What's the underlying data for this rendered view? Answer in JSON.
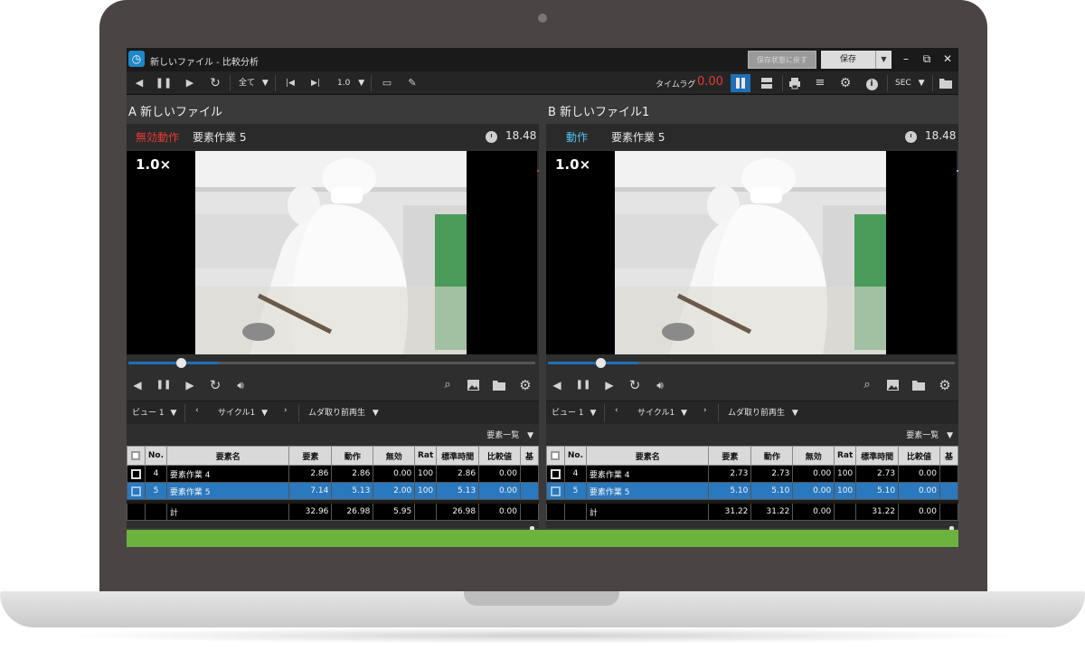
{
  "window": {
    "title": "新しいファイル - 比較分析",
    "revert_label": "保存状態に戻す",
    "save_label": "保存",
    "minimize": "–",
    "restore": "⧉",
    "close": "✕"
  },
  "toolbar": {
    "range_label": "全て",
    "speed_label": "1.0",
    "timelag_label": "タイムラグ",
    "timelag_value": "0.00",
    "unit_label": "SEC"
  },
  "panes": [
    {
      "title": "A  新しいファイル",
      "element_type": "無効動作",
      "element_name": "要素作業 5",
      "time": "18.48",
      "speed": "1.0×",
      "view_label": "ビュー 1",
      "cycle_label": "サイクル1",
      "mode_label": "ムダ取り前再生",
      "list_label": "要素一覧",
      "columns": [
        "No.",
        "要素名",
        "要素",
        "動作",
        "無効",
        "Rat",
        "標準時間",
        "比較値",
        "基"
      ],
      "rows": [
        {
          "no": "4",
          "name": "要素作業 4",
          "element": "2.86",
          "motion": "2.86",
          "invalid": "0.00",
          "rat": "100",
          "std": "2.86",
          "cmp": "0.00"
        },
        {
          "no": "5",
          "name": "要素作業 5",
          "element": "7.14",
          "motion": "5.13",
          "invalid": "2.00",
          "rat": "100",
          "std": "5.13",
          "cmp": "0.00"
        }
      ],
      "total": {
        "label": "計",
        "element": "32.96",
        "motion": "26.98",
        "invalid": "5.95",
        "std": "26.98",
        "cmp": "0.00"
      }
    },
    {
      "title": "B  新しいファイル1",
      "element_type": "動作",
      "element_name": "要素作業 5",
      "time": "18.48",
      "speed": "1.0×",
      "view_label": "ビュー 1",
      "cycle_label": "サイクル1",
      "mode_label": "ムダ取り前再生",
      "list_label": "要素一覧",
      "columns": [
        "No.",
        "要素名",
        "要素",
        "動作",
        "無効",
        "Rat",
        "標準時間",
        "比較値",
        "基"
      ],
      "rows": [
        {
          "no": "4",
          "name": "要素作業 4",
          "element": "2.73",
          "motion": "2.73",
          "invalid": "0.00",
          "rat": "100",
          "std": "2.73",
          "cmp": "0.00"
        },
        {
          "no": "5",
          "name": "要素作業 5",
          "element": "5.10",
          "motion": "5.10",
          "invalid": "0.00",
          "rat": "100",
          "std": "5.10",
          "cmp": "0.00"
        }
      ],
      "total": {
        "label": "計",
        "element": "31.22",
        "motion": "31.22",
        "invalid": "0.00",
        "std": "31.22",
        "cmp": "0.00"
      }
    }
  ],
  "colors": {
    "invalid_accent": "#e53935",
    "motion_accent": "#4fc3f7",
    "selected_row": "#2a78bd",
    "status_bar": "#6cb33e",
    "laptop_frame": "#4a4445"
  }
}
